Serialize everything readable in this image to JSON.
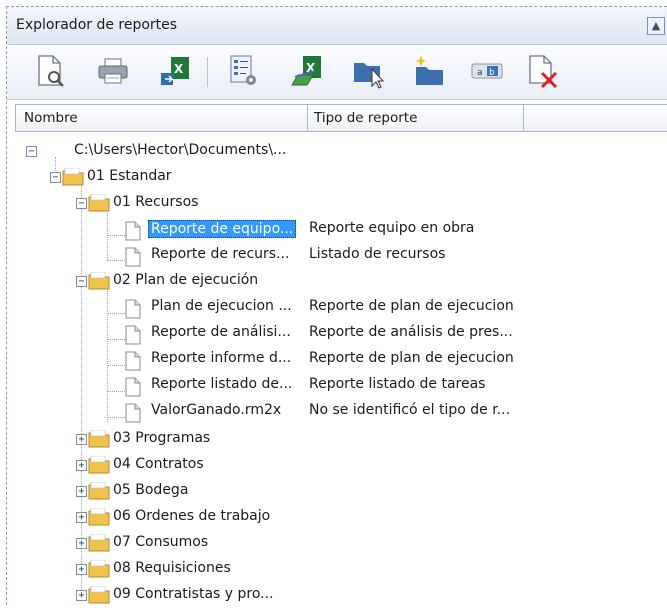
{
  "window": {
    "title": "Explorador de reportes",
    "pin_icon": "pin-icon"
  },
  "toolbar": {
    "buttons": [
      {
        "name": "preview-report-button",
        "icon": "document-magnifier-icon"
      },
      {
        "name": "print-button",
        "icon": "printer-icon"
      },
      {
        "name": "export-excel-button",
        "icon": "excel-export-icon"
      },
      {
        "name": "report-settings-button",
        "icon": "report-settings-icon"
      },
      {
        "name": "excel-edit-button",
        "icon": "excel-edit-icon"
      },
      {
        "name": "folder-select-button",
        "icon": "folder-cursor-icon"
      },
      {
        "name": "new-folder-button",
        "icon": "new-folder-icon"
      },
      {
        "name": "rename-button",
        "icon": "rename-icon"
      },
      {
        "name": "delete-report-button",
        "icon": "delete-document-icon"
      }
    ]
  },
  "columns": {
    "name": "Nombre",
    "type": "Tipo de reporte"
  },
  "tree": {
    "root": "C:\\Users\\Hector\\Documents\\...",
    "folder_01": "01 Estandar",
    "folder_0101": "01 Recursos",
    "reports_0101": [
      {
        "name": "Reporte de equipo...",
        "type": "Reporte equipo en obra"
      },
      {
        "name": "Reporte de recurs...",
        "type": "Listado de recursos"
      }
    ],
    "folder_0102": "02 Plan de ejecución",
    "reports_0102": [
      {
        "name": "Plan de ejecucion ...",
        "type": "Reporte de plan de ejecucion"
      },
      {
        "name": "Reporte de análisi...",
        "type": "Reporte de análisis de pres..."
      },
      {
        "name": "Reporte informe d...",
        "type": "Reporte de plan de ejecucion"
      },
      {
        "name": "Reporte listado de...",
        "type": "Reporte listado de tareas"
      },
      {
        "name": "ValorGanado.rm2x",
        "type": "No se identificó el tipo de r..."
      }
    ],
    "folders_collapsed": [
      "03 Programas",
      "04 Contratos",
      "05 Bodega",
      "06 Ordenes de trabajo",
      "07 Consumos",
      "08 Requisiciones",
      "09 Contratistas y pro..."
    ]
  },
  "colors": {
    "selection": "#3399ff",
    "folder": "#f2c24f"
  }
}
